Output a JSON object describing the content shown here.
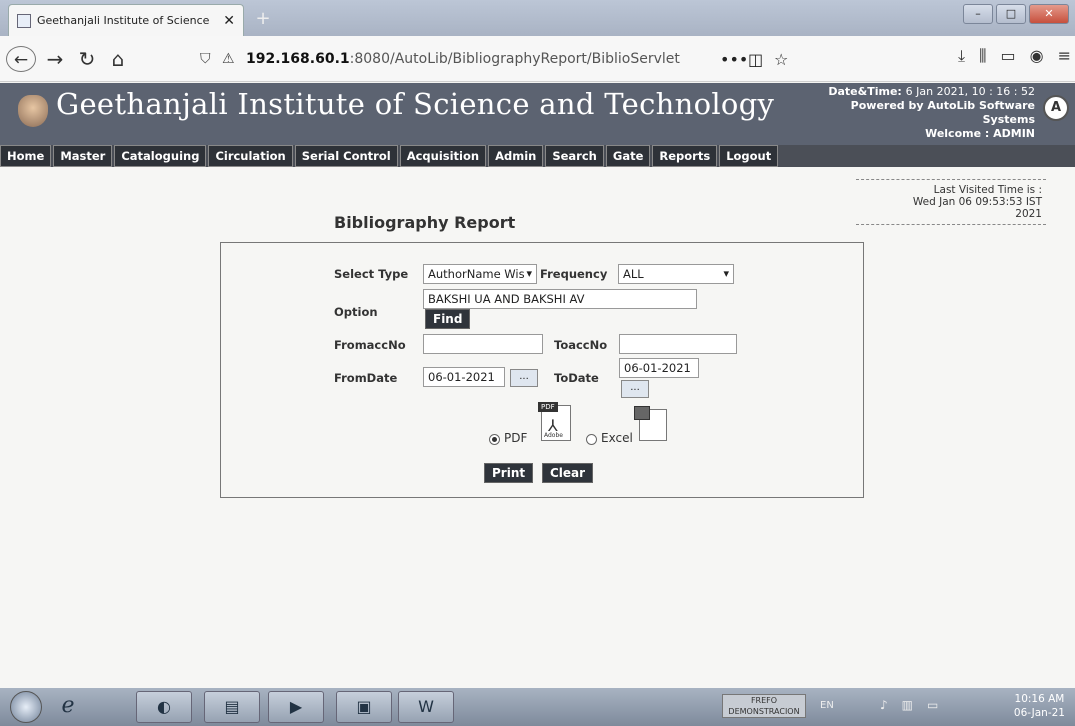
{
  "browser": {
    "tab_title": "Geethanjali Institute of Science",
    "tab_close": "✕",
    "new_tab": "+",
    "url_host": "192.168.60.1",
    "url_rest": ":8080/AutoLib/BibliographyReport/BiblioServlet",
    "more": "•••"
  },
  "header": {
    "institute": "Geethanjali Institute of Science and Technology",
    "datetime_label": "Date&Time:",
    "datetime_value": "6 Jan 2021, 10 : 16 : 52",
    "powered": "Powered by AutoLib Software",
    "systems": "Systems",
    "welcome": "Welcome   :  ADMIN"
  },
  "menu": [
    "Home",
    "Master",
    "Cataloguing",
    "Circulation",
    "Serial Control",
    "Acquisition",
    "Admin",
    "Search",
    "Gate",
    "Reports",
    "Logout"
  ],
  "last_visited": {
    "label": "Last Visited Time is :",
    "line1": "Wed Jan 06 09:53:53 IST",
    "line2": "2021"
  },
  "report": {
    "title": "Bibliography Report",
    "select_type_label": "Select Type",
    "select_type_value": "AuthorName Wis",
    "frequency_label": "Frequency",
    "frequency_value": "ALL",
    "option_label": "Option",
    "option_value": "BAKSHI UA AND  BAKSHI AV",
    "find": "Find",
    "fromaccno_label": "FromaccNo",
    "toaccno_label": "ToaccNo",
    "fromdate_label": "FromDate",
    "fromdate_value": "06-01-2021",
    "todate_label": "ToDate",
    "todate_value": "06-01-2021",
    "date_btn": "...",
    "pdf_label": "PDF",
    "excel_label": "Excel",
    "pdf_badge": "PDF",
    "adobe_badge": "Adobe",
    "print": "Print",
    "clear": "Clear",
    "selected_format": "PDF"
  },
  "taskbar": {
    "tray_app_line1": "FREFO",
    "tray_app_line2": "DEMONSTRACION",
    "lang": "EN",
    "time": "10:16 AM",
    "date": "06-Jan-21"
  }
}
